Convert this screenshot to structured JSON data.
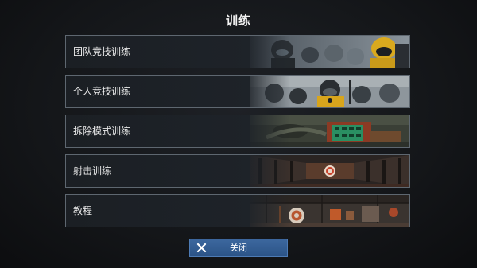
{
  "screen": {
    "title": "训练"
  },
  "menu": {
    "items": [
      {
        "label": "团队竞技训练",
        "thumb_icon": "team-operators-icon"
      },
      {
        "label": "个人竞技训练",
        "thumb_icon": "solo-operator-icon"
      },
      {
        "label": "拆除模式训练",
        "thumb_icon": "bomb-defuse-icon"
      },
      {
        "label": "射击训练",
        "thumb_icon": "shooting-target-icon"
      },
      {
        "label": "教程",
        "thumb_icon": "tutorial-range-icon"
      }
    ]
  },
  "footer": {
    "close_label": "关闭"
  },
  "colors": {
    "accent_yellow": "#e8b323",
    "button_blue": "#345f96",
    "item_border": "#5e6770",
    "target_red": "#c8412a"
  }
}
